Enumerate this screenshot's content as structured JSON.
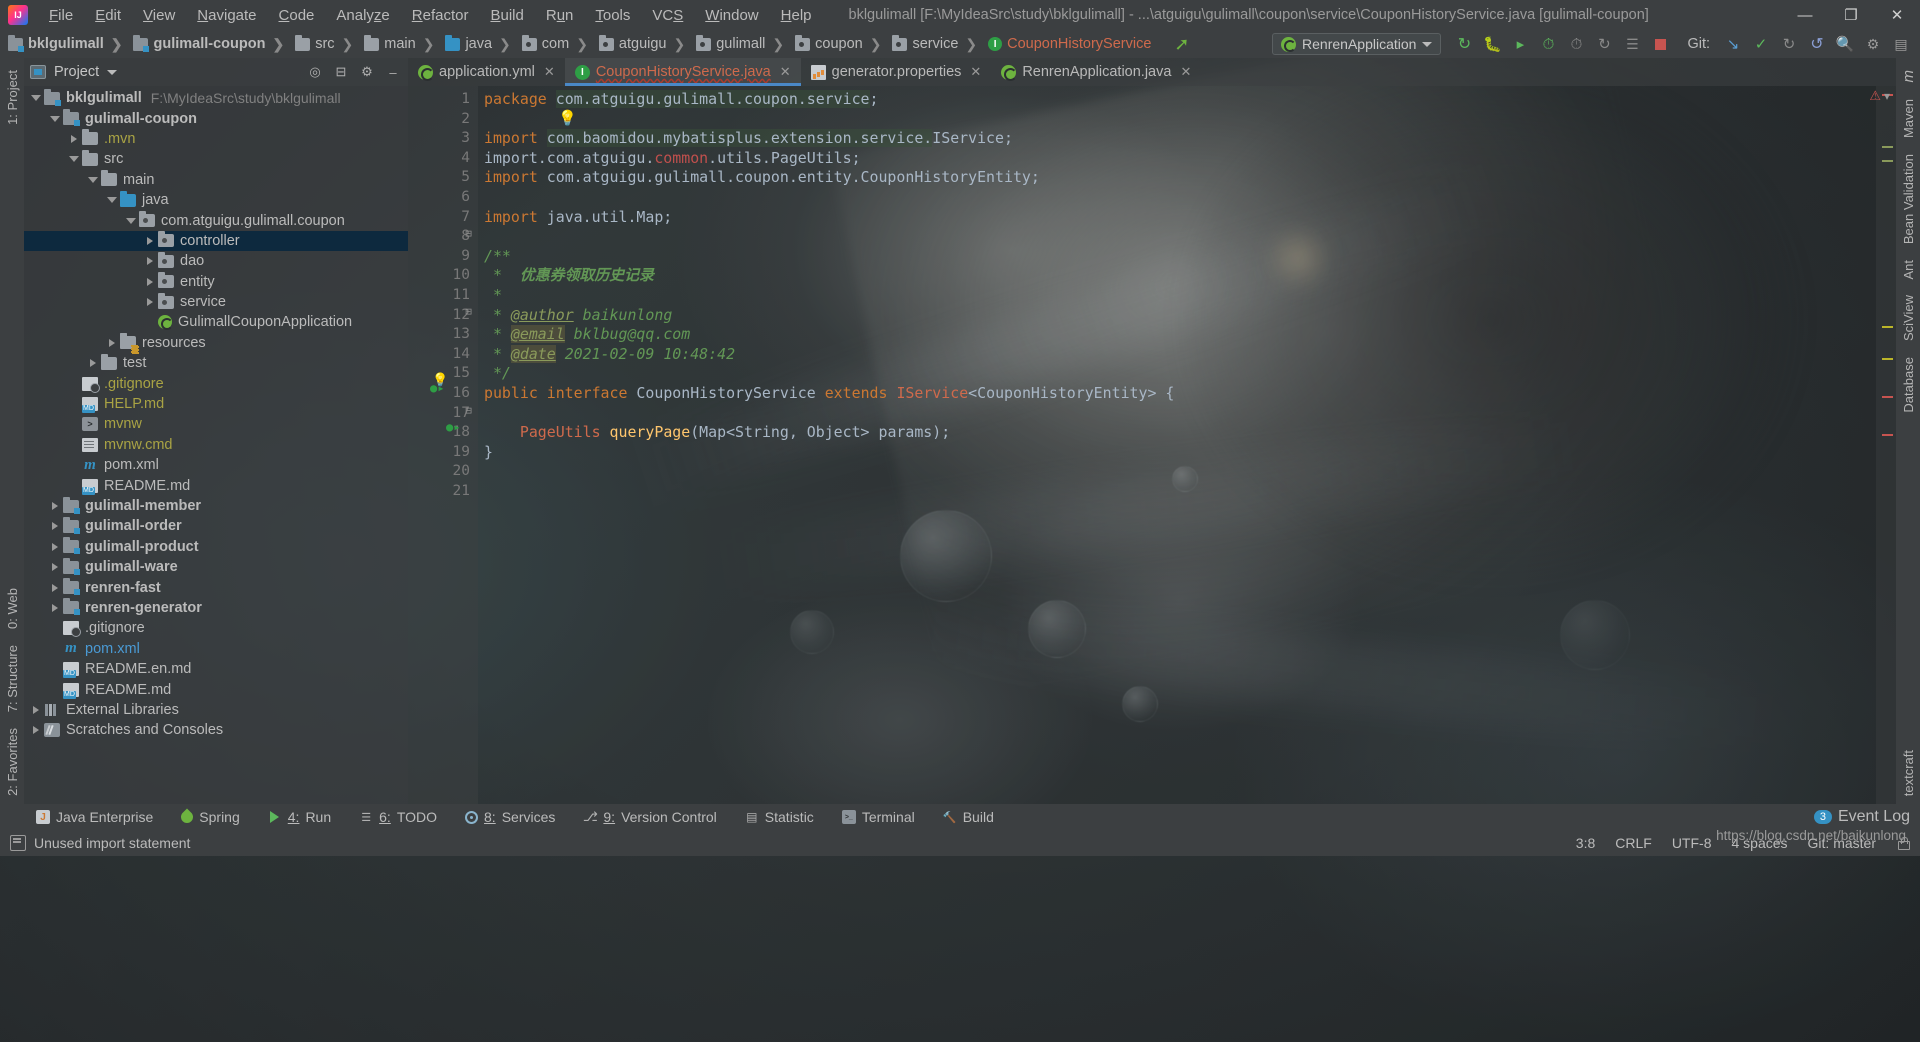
{
  "window": {
    "title": "bklgulimall [F:\\MyIdeaSrc\\study\\bklgulimall] - ...\\atguigu\\gulimall\\coupon\\service\\CouponHistoryService.java [gulimall-coupon]",
    "minimize": "—",
    "maximize": "❐",
    "close": "✕"
  },
  "menu": {
    "items": [
      "File",
      "Edit",
      "View",
      "Navigate",
      "Code",
      "Analyze",
      "Refactor",
      "Build",
      "Run",
      "Tools",
      "VCS",
      "Window",
      "Help"
    ]
  },
  "navbar": {
    "crumbs": [
      {
        "label": "bklgulimall",
        "icon": "module-icon",
        "style": "bold"
      },
      {
        "label": "gulimall-coupon",
        "icon": "module-icon",
        "style": "bold"
      },
      {
        "label": "src",
        "icon": "folder-icon",
        "style": "normal"
      },
      {
        "label": "main",
        "icon": "folder-icon",
        "style": "normal"
      },
      {
        "label": "java",
        "icon": "source-folder-icon",
        "style": "normal"
      },
      {
        "label": "com",
        "icon": "package-icon",
        "style": "normal"
      },
      {
        "label": "atguigu",
        "icon": "package-icon",
        "style": "normal"
      },
      {
        "label": "gulimall",
        "icon": "package-icon",
        "style": "normal"
      },
      {
        "label": "coupon",
        "icon": "package-icon",
        "style": "normal"
      },
      {
        "label": "service",
        "icon": "package-icon",
        "style": "normal"
      },
      {
        "label": "CouponHistoryService",
        "icon": "interface-icon",
        "style": "red"
      }
    ],
    "run_config": "RenrenApplication",
    "git_label": "Git:",
    "toolbar_icons": [
      "rerun-icon",
      "debug-icon",
      "run-with-coverage-icon",
      "profiler-icon",
      "attach-process-icon",
      "stop-icon",
      "search-everywhere-icon"
    ]
  },
  "project_panel": {
    "title": "Project",
    "header_icons": [
      "locate-icon",
      "collapse-all-icon",
      "settings-icon",
      "hide-icon"
    ],
    "tree": [
      {
        "depth": 0,
        "label": "bklgulimall",
        "path": "F:\\MyIdeaSrc\\study\\bklgulimall",
        "icon": "module-icon",
        "arrow": "open",
        "style": "bold"
      },
      {
        "depth": 1,
        "label": "gulimall-coupon",
        "path": "",
        "icon": "module-icon",
        "arrow": "open",
        "style": "bold"
      },
      {
        "depth": 2,
        "label": ".mvn",
        "path": "",
        "icon": "folder-icon",
        "arrow": "closed",
        "style": "yellow"
      },
      {
        "depth": 2,
        "label": "src",
        "path": "",
        "icon": "folder-icon",
        "arrow": "open",
        "style": "normal"
      },
      {
        "depth": 3,
        "label": "main",
        "path": "",
        "icon": "folder-icon",
        "arrow": "open",
        "style": "normal"
      },
      {
        "depth": 4,
        "label": "java",
        "path": "",
        "icon": "source-folder-icon",
        "arrow": "open",
        "style": "normal"
      },
      {
        "depth": 5,
        "label": "com.atguigu.gulimall.coupon",
        "path": "",
        "icon": "package-icon",
        "arrow": "open",
        "style": "normal"
      },
      {
        "depth": 6,
        "label": "controller",
        "path": "",
        "icon": "package-icon",
        "arrow": "closed",
        "style": "normal",
        "selected": true
      },
      {
        "depth": 6,
        "label": "dao",
        "path": "",
        "icon": "package-icon",
        "arrow": "closed",
        "style": "normal"
      },
      {
        "depth": 6,
        "label": "entity",
        "path": "",
        "icon": "package-icon",
        "arrow": "closed",
        "style": "normal"
      },
      {
        "depth": 6,
        "label": "service",
        "path": "",
        "icon": "package-icon",
        "arrow": "closed",
        "style": "normal"
      },
      {
        "depth": 6,
        "label": "GulimallCouponApplication",
        "path": "",
        "icon": "spring-class-icon",
        "arrow": "none",
        "style": "normal"
      },
      {
        "depth": 4,
        "label": "resources",
        "path": "",
        "icon": "resources-folder-icon",
        "arrow": "closed",
        "style": "normal"
      },
      {
        "depth": 3,
        "label": "test",
        "path": "",
        "icon": "folder-icon",
        "arrow": "closed",
        "style": "normal"
      },
      {
        "depth": 2,
        "label": ".gitignore",
        "path": "",
        "icon": "gitignore-file-icon",
        "arrow": "none",
        "style": "yellow"
      },
      {
        "depth": 2,
        "label": "HELP.md",
        "path": "",
        "icon": "markdown-file-icon",
        "arrow": "none",
        "style": "yellow"
      },
      {
        "depth": 2,
        "label": "mvnw",
        "path": "",
        "icon": "shell-file-icon",
        "arrow": "none",
        "style": "yellow"
      },
      {
        "depth": 2,
        "label": "mvnw.cmd",
        "path": "",
        "icon": "text-file-icon",
        "arrow": "none",
        "style": "yellow"
      },
      {
        "depth": 2,
        "label": "pom.xml",
        "path": "",
        "icon": "maven-file-icon",
        "arrow": "none",
        "style": "normal"
      },
      {
        "depth": 2,
        "label": "README.md",
        "path": "",
        "icon": "markdown-file-icon",
        "arrow": "none",
        "style": "normal"
      },
      {
        "depth": 1,
        "label": "gulimall-member",
        "path": "",
        "icon": "module-icon",
        "arrow": "closed",
        "style": "bold"
      },
      {
        "depth": 1,
        "label": "gulimall-order",
        "path": "",
        "icon": "module-icon",
        "arrow": "closed",
        "style": "bold"
      },
      {
        "depth": 1,
        "label": "gulimall-product",
        "path": "",
        "icon": "module-icon",
        "arrow": "closed",
        "style": "bold"
      },
      {
        "depth": 1,
        "label": "gulimall-ware",
        "path": "",
        "icon": "module-icon",
        "arrow": "closed",
        "style": "bold"
      },
      {
        "depth": 1,
        "label": "renren-fast",
        "path": "",
        "icon": "module-icon",
        "arrow": "closed",
        "style": "bold"
      },
      {
        "depth": 1,
        "label": "renren-generator",
        "path": "",
        "icon": "module-icon",
        "arrow": "closed",
        "style": "bold"
      },
      {
        "depth": 1,
        "label": ".gitignore",
        "path": "",
        "icon": "gitignore-file-icon",
        "arrow": "none",
        "style": "normal"
      },
      {
        "depth": 1,
        "label": "pom.xml",
        "path": "",
        "icon": "maven-file-icon",
        "arrow": "none",
        "style": "blue"
      },
      {
        "depth": 1,
        "label": "README.en.md",
        "path": "",
        "icon": "markdown-file-icon",
        "arrow": "none",
        "style": "normal"
      },
      {
        "depth": 1,
        "label": "README.md",
        "path": "",
        "icon": "markdown-file-icon",
        "arrow": "none",
        "style": "normal"
      },
      {
        "depth": 0,
        "label": "External Libraries",
        "path": "",
        "icon": "libraries-icon",
        "arrow": "closed",
        "style": "normal"
      },
      {
        "depth": 0,
        "label": "Scratches and Consoles",
        "path": "",
        "icon": "scratches-icon",
        "arrow": "closed",
        "style": "normal"
      }
    ]
  },
  "left_strip": {
    "top": [
      "1: Project"
    ],
    "bottom": [
      "0: Web",
      "7: Structure",
      "2: Favorites"
    ]
  },
  "right_strip": {
    "items": [
      "m",
      "Maven",
      "Bean Validation",
      "Ant",
      "SciView",
      "Database",
      "textcraft"
    ]
  },
  "editor_tabs": [
    {
      "label": "application.yml",
      "icon": "spring-yaml-icon",
      "active": false,
      "closable": true
    },
    {
      "label": "CouponHistoryService.java",
      "icon": "interface-icon",
      "active": true,
      "closable": true
    },
    {
      "label": "generator.properties",
      "icon": "properties-file-icon",
      "active": false,
      "closable": true
    },
    {
      "label": "RenrenApplication.java",
      "icon": "spring-class-icon",
      "active": false,
      "closable": true
    }
  ],
  "code": {
    "line_numbers": [
      1,
      2,
      3,
      4,
      5,
      6,
      7,
      8,
      9,
      10,
      11,
      12,
      13,
      14,
      15,
      16,
      17,
      18,
      19,
      20,
      21
    ],
    "lines": [
      "package com.atguigu.gulimall.coupon.service;",
      "",
      "import com.baomidou.mybatisplus.extension.service.IService;",
      "import com.atguigu.common.utils.PageUtils;",
      "import com.atguigu.gulimall.coupon.entity.CouponHistoryEntity;",
      "",
      "import java.util.Map;",
      "",
      "/**",
      " * 优惠券领取历史记录",
      " *",
      " * @author baikunlong",
      " * @email bklbug@qq.com",
      " * @date 2021-02-09 10:48:42",
      " */",
      "public interface CouponHistoryService extends IService<CouponHistoryEntity> {",
      "",
      "    PageUtils queryPage(Map<String, Object> params);",
      "}",
      "",
      ""
    ]
  },
  "bottom_bar": {
    "items": [
      {
        "label": "Java Enterprise",
        "num": "",
        "icon": "java-enterprise-icon"
      },
      {
        "label": "Spring",
        "num": "",
        "icon": "spring-icon"
      },
      {
        "label": "Run",
        "num": "4:",
        "icon": "run-icon"
      },
      {
        "label": "TODO",
        "num": "6:",
        "icon": "todo-icon"
      },
      {
        "label": "Services",
        "num": "8:",
        "icon": "services-icon"
      },
      {
        "label": "Version Control",
        "num": "9:",
        "icon": "version-control-icon"
      },
      {
        "label": "Statistic",
        "num": "",
        "icon": "statistic-icon"
      },
      {
        "label": "Terminal",
        "num": "",
        "icon": "terminal-icon"
      },
      {
        "label": "Build",
        "num": "",
        "icon": "build-icon"
      }
    ],
    "event_log": {
      "label": "Event Log",
      "badge": "3"
    }
  },
  "status_bar": {
    "message": "Unused import statement",
    "caret": "3:8",
    "line_sep": "CRLF",
    "encoding": "UTF-8",
    "indent": "4 spaces",
    "branch": "Git: master"
  },
  "watermark": "https://blog.csdn.net/baikunlong",
  "colors": {
    "accent": "#4a88c7",
    "selection": "#0d293e",
    "panel": "#3c3f41",
    "keyword": "#cc7832",
    "comment": "#629755",
    "error": "#cf6a4c",
    "string": "#6a8759",
    "green_run": "#6db33f"
  }
}
